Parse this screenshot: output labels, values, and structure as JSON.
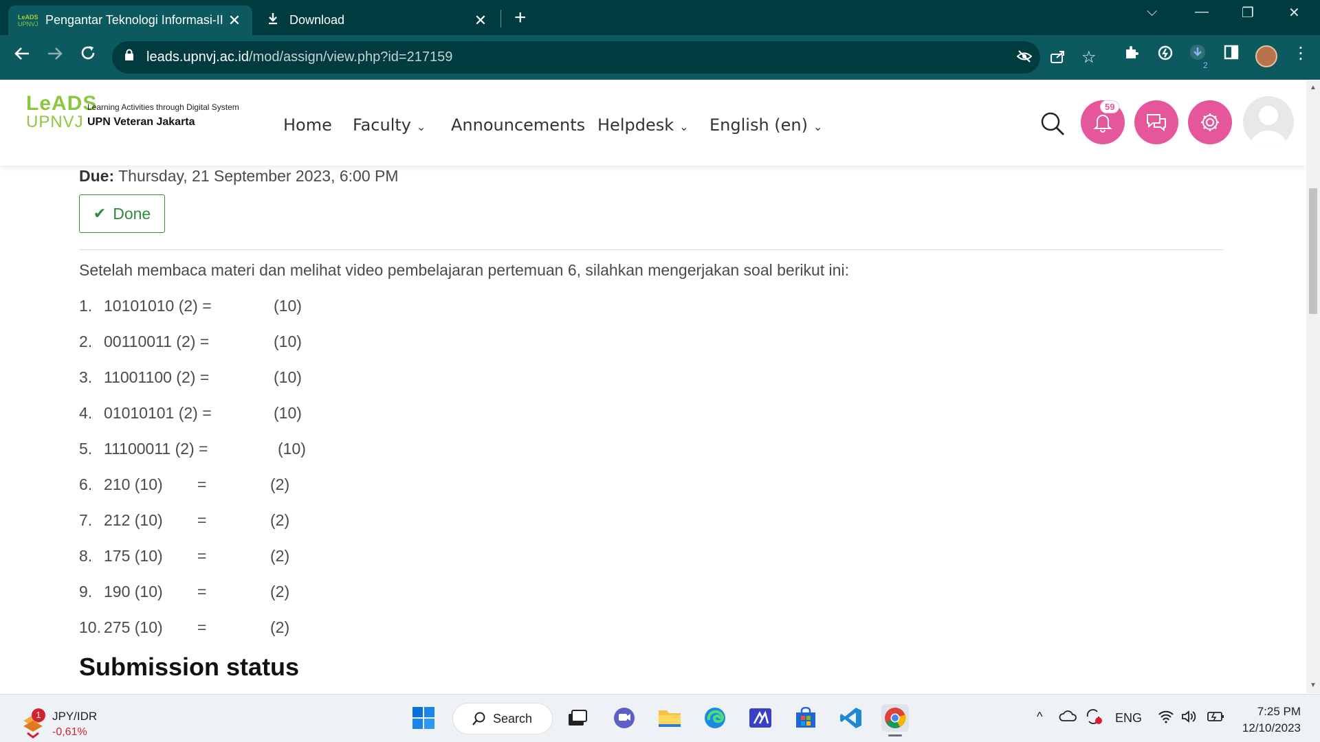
{
  "browser": {
    "tabs": [
      {
        "title": "Pengantar Teknologi Informasi-II",
        "favicon_text": "LeADS UPNVJ",
        "active": true
      },
      {
        "title": "Download",
        "active": false
      }
    ],
    "url_domain": "leads.upnvj.ac.id",
    "url_path": "/mod/assign/view.php?id=217159",
    "download_count": "2"
  },
  "site": {
    "logo_top": "LeADS",
    "logo_bottom": "UPNVJ",
    "tagline": "Learning Activities through Digital System",
    "institution": "UPN Veteran Jakarta",
    "nav": {
      "home": "Home",
      "faculty": "Faculty",
      "announcements": "Announcements",
      "helpdesk": "Helpdesk",
      "language": "English (en)"
    },
    "notification_count": "59"
  },
  "assignment": {
    "due_label": "Due:",
    "due_value": "Thursday, 21 September 2023, 6:00 PM",
    "done_label": "Done",
    "intro": "Setelah membaca materi dan melihat video pembelajaran pertemuan 6, silahkan mengerjakan soal berikut ini:",
    "questions": [
      {
        "num": "1.",
        "value": "10101010 (2) =",
        "eq": "",
        "base": "(10)"
      },
      {
        "num": "2.",
        "value": "00110011 (2) =",
        "eq": "",
        "base": "(10)"
      },
      {
        "num": "3.",
        "value": "11001100 (2) =",
        "eq": "",
        "base": "(10)"
      },
      {
        "num": "4.",
        "value": "01010101 (2) =",
        "eq": "",
        "base": "(10)"
      },
      {
        "num": "5.",
        "value": "11100011  (2) =",
        "eq": "",
        "base": "(10)"
      },
      {
        "num": "6.",
        "value": "210  (10)",
        "eq": "=",
        "base": "(2)"
      },
      {
        "num": "7.",
        "value": "212  (10)",
        "eq": "=",
        "base": "(2)"
      },
      {
        "num": "8.",
        "value": "175  (10)",
        "eq": "=",
        "base": "(2)"
      },
      {
        "num": "9.",
        "value": "190  (10)",
        "eq": "=",
        "base": "(2)"
      },
      {
        "num": "10.",
        "value": "275  (10)",
        "eq": "=",
        "base": "(2)"
      }
    ],
    "submission_heading": "Submission status"
  },
  "taskbar": {
    "ticker_symbol": "JPY/IDR",
    "ticker_change": "-0,61%",
    "ticker_notif": "1",
    "search_label": "Search",
    "language": "ENG",
    "time": "7:25 PM",
    "date": "12/10/2023"
  },
  "colors": {
    "chrome_dark": "#003b3f",
    "chrome_toolbar": "#0c5a5f",
    "accent_pink": "#e5569b",
    "done_green": "#2e8b3c",
    "logo_green": "#8dc63f"
  }
}
